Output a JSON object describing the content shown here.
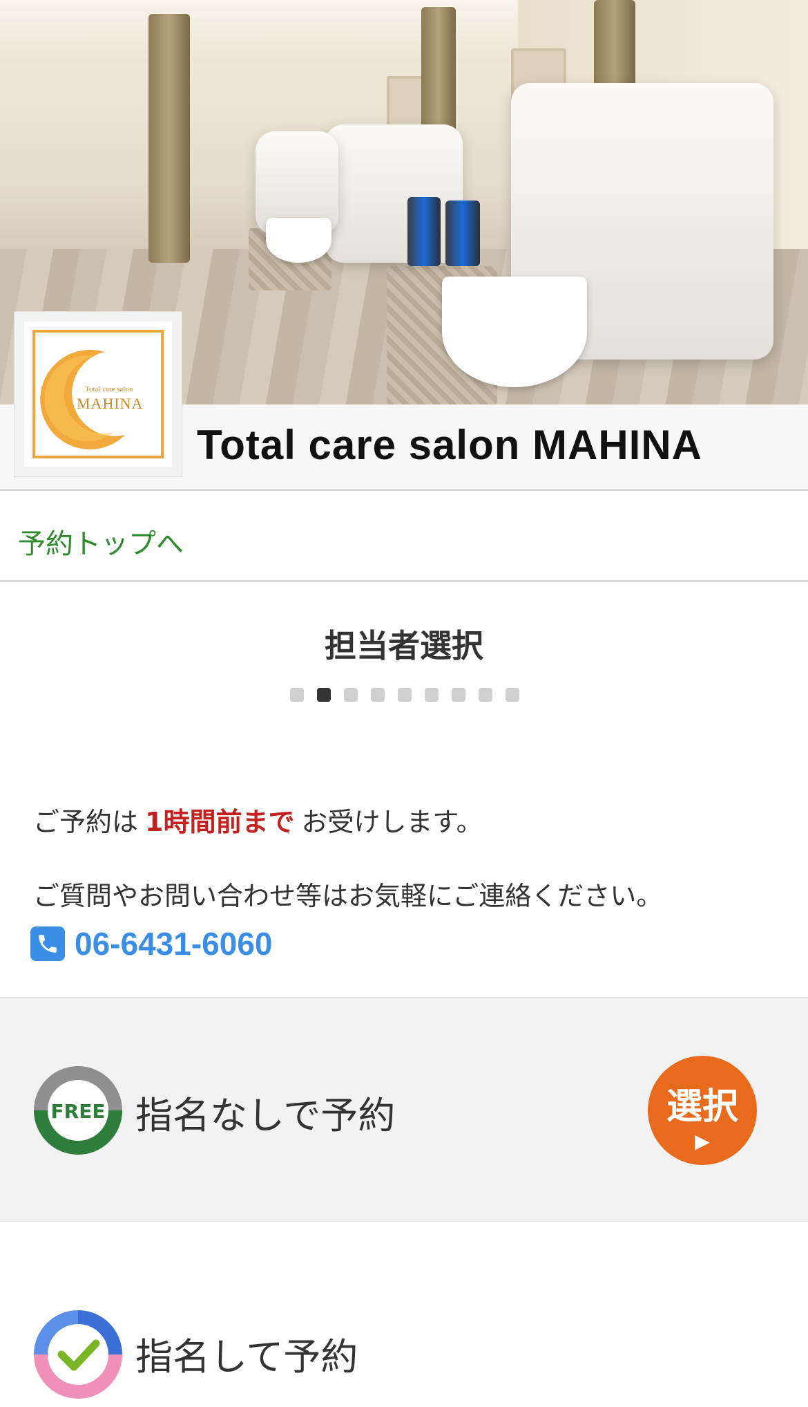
{
  "hero": {
    "logo_text_small": "Total care salon",
    "logo_text_main": "MAHINA"
  },
  "header": {
    "salon_name": "Total care salon MAHINA"
  },
  "nav": {
    "back_link": "予約トップへ"
  },
  "step": {
    "title": "担当者選択",
    "total_steps": 9,
    "current_step": 2
  },
  "info": {
    "line1_before": "ご予約は",
    "line1_strong": "1時間前まで",
    "line1_after": "お受けします。",
    "line2": "ご質問やお問い合わせ等はお気軽にご連絡ください。",
    "phone": "06-6431-6060"
  },
  "options": {
    "free": {
      "icon_label": "FREE",
      "label": "指名なしで予約",
      "button": "選択",
      "button_arrow": "▶"
    },
    "named": {
      "label": "指名して予約"
    }
  },
  "colors": {
    "link_green": "#2e8b2e",
    "alert_red": "#c32020",
    "phone_blue": "#3a8ee6",
    "button_orange": "#ea6a1c",
    "logo_orange": "#f0a53d"
  }
}
